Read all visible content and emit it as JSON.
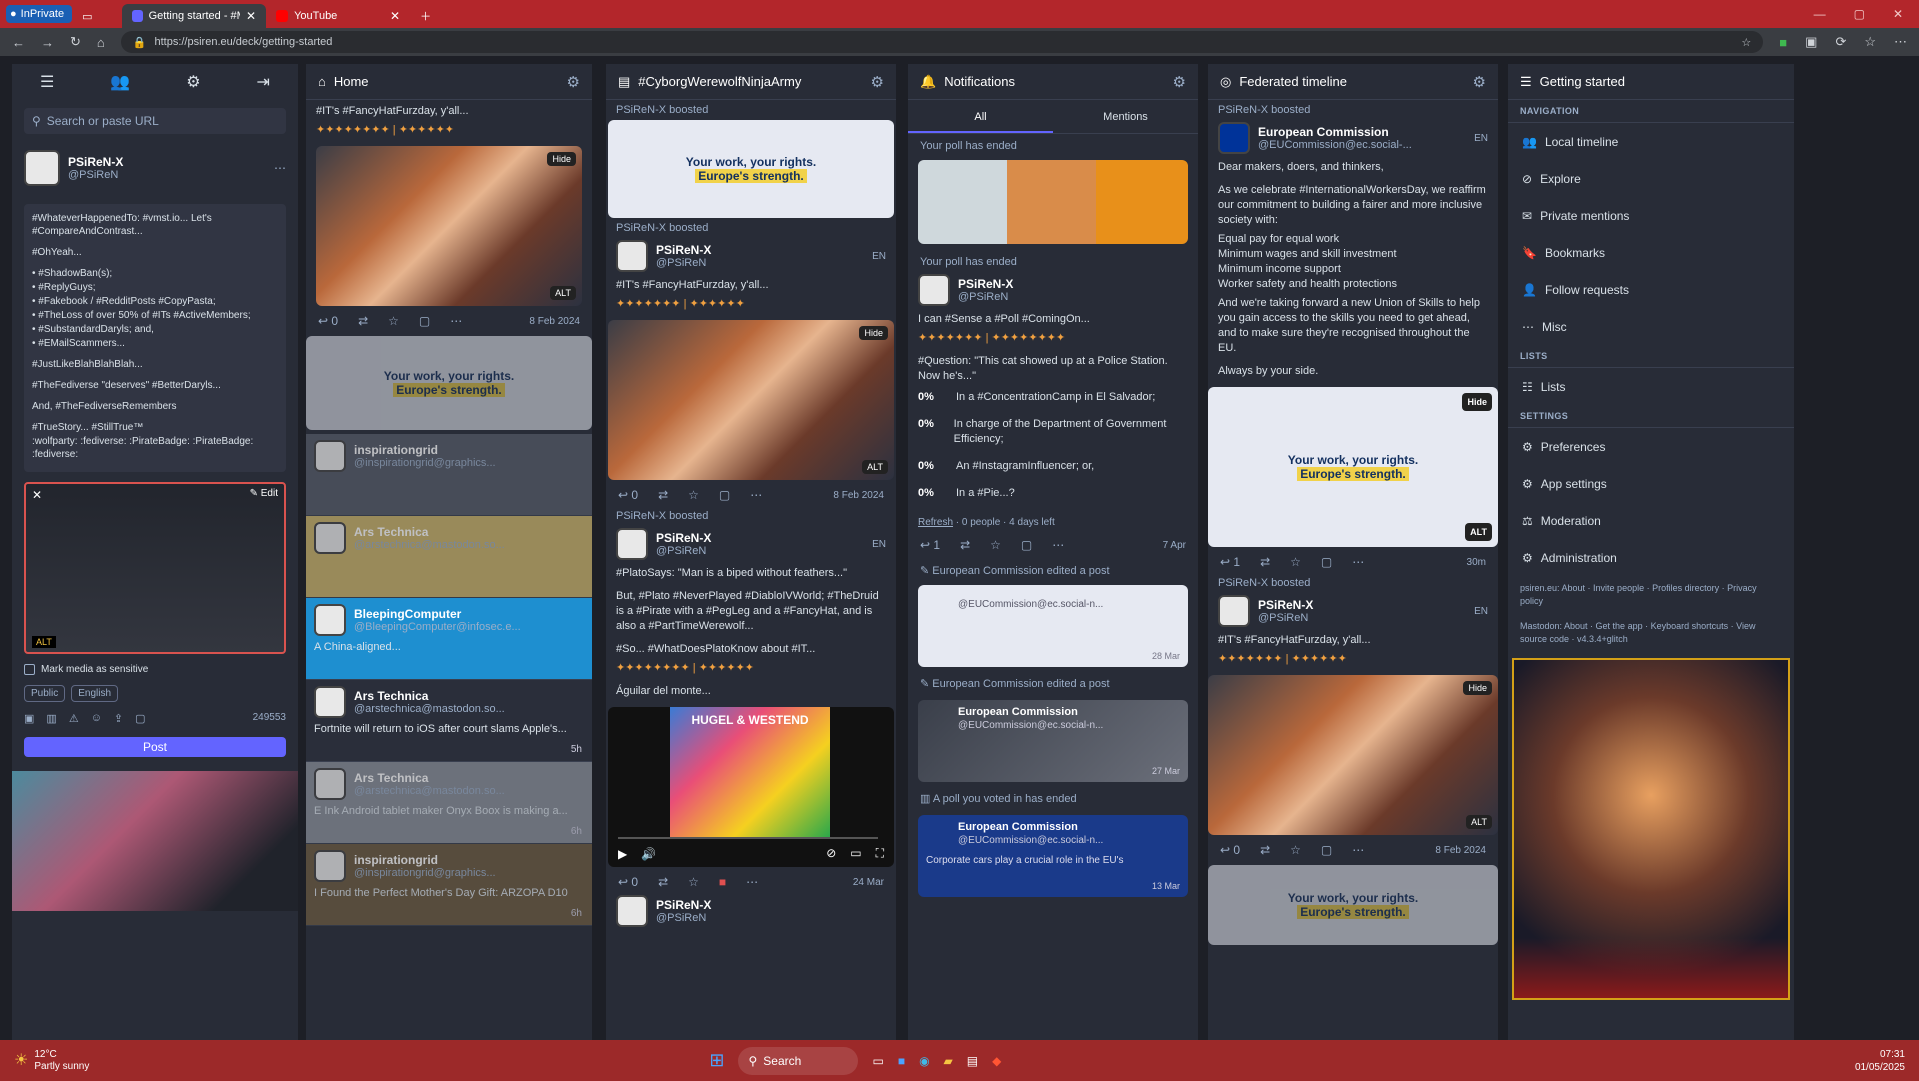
{
  "browser": {
    "inprivate": "InPrivate",
    "tabs": [
      {
        "title": "Getting started - #MastodonSpy..."
      },
      {
        "title": "YouTube"
      }
    ],
    "url": "https://psiren.eu/deck/getting-started"
  },
  "sidebar": {
    "search_placeholder": "Search or paste URL",
    "user_name": "PSiReN-X",
    "user_handle": "@PSiReN",
    "compose_lines": [
      "#WhateverHappenedTo: #vmst.io... Let's #CompareAndContrast...",
      "#OhYeah...",
      "•  #ShadowBan(s);",
      "•  #ReplyGuys;",
      "•  #Fakebook / #RedditPosts #CopyPasta;",
      "•  #TheLoss of over 50% of #ITs #ActiveMembers;",
      "•  #SubstandardDaryls; and,",
      "•  #EMailScammers...",
      "#JustLikeBlahBlahBlah...",
      "#TheFediverse \"deserves\" #BetterDaryls...",
      "And, #TheFediverseRemembers",
      "#TrueStory... #StillTrue™",
      ":wolfparty: :fediverse: :PirateBadge: :PirateBadge: :fediverse:"
    ],
    "edit_label": "Edit",
    "alt_label": "ALT",
    "sensitive_label": "Mark media as sensitive",
    "visibility": "Public",
    "language": "English",
    "char_count": "249553",
    "post_label": "Post"
  },
  "home": {
    "title": "Home",
    "first_text": "#IT's #FancyHatFurzday, y'all...",
    "hide": "Hide",
    "alt": "ALT",
    "date": "8 Feb 2024",
    "reply_count": "0",
    "eu_line1": "Your work, your rights.",
    "eu_line2": "Europe's strength.",
    "items": [
      {
        "name": "inspirationgrid",
        "handle": "@inspirationgrid@graphics..."
      },
      {
        "name": "Ars Technica",
        "handle": "@arstechnica@mastodon.so..."
      },
      {
        "name": "BleepingComputer",
        "handle": "@BleepingComputer@infosec.e...",
        "text": "A China-aligned..."
      },
      {
        "name": "Ars Technica",
        "handle": "@arstechnica@mastodon.so...",
        "text": "Fortnite will return to iOS after court slams Apple's..."
      },
      {
        "name": "Ars Technica",
        "handle": "@arstechnica@mastodon.so...",
        "text": "E Ink Android tablet maker Onyx Boox is making a..."
      },
      {
        "name": "inspirationgrid",
        "handle": "@inspirationgrid@graphics...",
        "text": "I Found the Perfect Mother's Day Gift: ARZOPA D10"
      }
    ],
    "times": [
      "5h",
      "6h",
      "6h"
    ]
  },
  "cyborg": {
    "title": "#CyborgWerewolfNinjaArmy",
    "boosted": "PSiReN-X boosted",
    "author": "PSiReN-X",
    "handle": "@PSiReN",
    "lang": "EN",
    "post1_text": "#IT's #FancyHatFurzday, y'all...",
    "post1_date": "8 Feb 2024",
    "post2_lines": [
      "#PlatoSays: \"Man is a biped without feathers...\"",
      "But, #Plato #NeverPlayed #DiabloIVWorld; #TheDruid is a #Pirate with a #PegLeg and a #FancyHat, and is also a #PartTimeWerewolf...",
      "#So... #WhatDoesPlatoKnow about #IT..."
    ],
    "music": "Águilar del monte...",
    "video_caption": "HUGEL & WESTEND",
    "post2_date": "24 Mar"
  },
  "notifications": {
    "title": "Notifications",
    "tab_all": "All",
    "tab_mentions": "Mentions",
    "poll_ended": "Your poll has ended",
    "poll_author": "PSiReN-X",
    "poll_handle": "@PSiReN",
    "poll_intro": "I can #Sense a #Poll #ComingOn...",
    "poll_question": "#Question: \"This cat showed up at a Police Station. Now he's...\"",
    "options": [
      {
        "pct": "0%",
        "text": "In a #ConcentrationCamp in El Salvador;"
      },
      {
        "pct": "0%",
        "text": "In charge of the Department of Government Efficiency;"
      },
      {
        "pct": "0%",
        "text": "An #InstagramInfluencer; or,"
      },
      {
        "pct": "0%",
        "text": "In a #Pie...?"
      }
    ],
    "refresh": "Refresh",
    "poll_meta": "· 0 people · 4 days left",
    "poll_date": "7 Apr",
    "edited": "European Commission edited a post",
    "ec_handle": "@EUCommission@ec.social-n...",
    "ec_name": "European Commission",
    "edit_date1": "28 Mar",
    "edit_date2": "27 Mar",
    "voted_ended": "A poll you voted in has ended",
    "voted_text": "Corporate cars play a crucial role in the EU's",
    "voted_date": "13 Mar"
  },
  "federated": {
    "title": "Federated timeline",
    "boosted": "PSiReN-X boosted",
    "ec_name": "European Commission",
    "ec_handle": "@EUCommission@ec.social-...",
    "lang": "EN",
    "lines": [
      "Dear makers, doers, and thinkers,",
      "As we celebrate #InternationalWorkersDay, we reaffirm our commitment to building a fairer and more inclusive society with:",
      "Equal pay for equal work",
      "Minimum wages and skill investment",
      "Minimum income support",
      "Worker safety and health protections",
      "And we're taking forward a new Union of Skills to help you gain access to the skills you need to get ahead, and to make sure they're recognised throughout the EU.",
      "Always by your side."
    ],
    "hide": "Hide",
    "alt": "ALT",
    "time": "30m",
    "reply1": "1",
    "author": "PSiReN-X",
    "handle": "@PSiReN",
    "post2_text": "#IT's #FancyHatFurzday, y'all...",
    "post2_date": "8 Feb 2024"
  },
  "getting_started": {
    "title": "Getting started",
    "navigation": "NAVIGATION",
    "nav_items": [
      "Local timeline",
      "Explore",
      "Private mentions",
      "Bookmarks",
      "Follow requests",
      "Misc"
    ],
    "lists_header": "LISTS",
    "lists": "Lists",
    "settings_header": "SETTINGS",
    "settings_items": [
      "Preferences",
      "App settings",
      "Moderation",
      "Administration"
    ],
    "footer1": "psiren.eu: About · Invite people · Profiles directory · Privacy policy",
    "footer2": "Mastodon: About · Get the app · Keyboard shortcuts · View source code · v4.3.4+glitch"
  },
  "taskbar": {
    "temp": "12°C",
    "weather": "Partly sunny",
    "search": "Search",
    "time": "07:31",
    "date": "01/05/2025"
  },
  "colors": {
    "accent": "#6364ff",
    "tabbar": "#b3262b",
    "panel": "#282c37"
  }
}
